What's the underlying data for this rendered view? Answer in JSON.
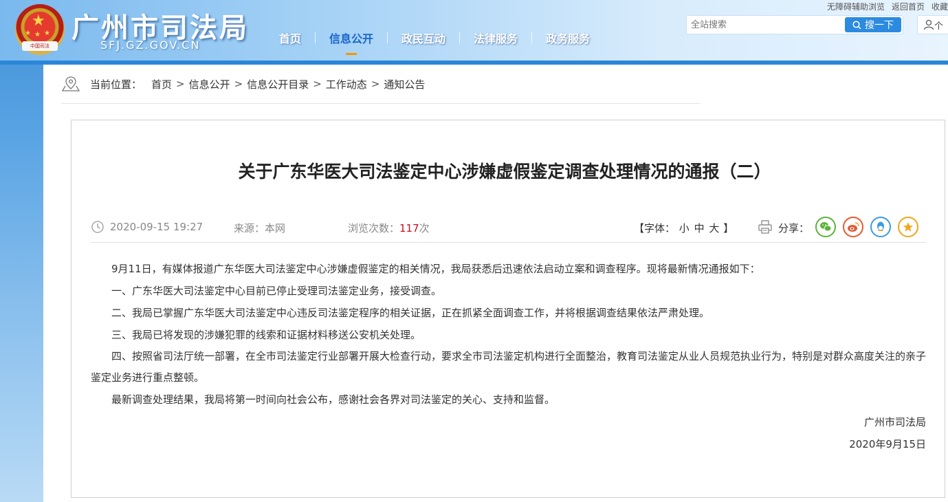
{
  "header": {
    "site_title": "广州市司法局",
    "site_domain": "SFJ.GZ.GOV.CN",
    "emblem_text": "中国司法",
    "top_links": [
      "无障碍辅助浏览",
      "返回首页",
      "收藏"
    ],
    "nav": [
      {
        "label": "首页",
        "active": false
      },
      {
        "label": "信息公开",
        "active": true
      },
      {
        "label": "政民互动",
        "active": false
      },
      {
        "label": "法律服务",
        "active": false
      },
      {
        "label": "政务服务",
        "active": false
      }
    ],
    "search": {
      "placeholder": "全站搜索",
      "button_label": "搜一下"
    },
    "user_label": "个"
  },
  "breadcrumb": {
    "label": "当前位置：",
    "items": [
      "首页",
      "信息公开",
      "信息公开目录",
      "工作动态",
      "通知公告"
    ]
  },
  "article": {
    "title": "关于广东华医大司法鉴定中心涉嫌虚假鉴定调查处理情况的通报（二）",
    "date": "2020-09-15 19:27",
    "source": "来源：本网",
    "views_label": "浏览次数：",
    "views_count": "117",
    "views_unit": "次",
    "font_open": "【字体：",
    "font_sizes": [
      "小",
      "中",
      "大"
    ],
    "font_close": "】",
    "share_label": "分享：",
    "share_targets": [
      "wechat-icon",
      "weibo-icon",
      "qq-icon",
      "favorite-icon"
    ],
    "paragraphs": [
      "9月11日，有媒体报道广东华医大司法鉴定中心涉嫌虚假鉴定的相关情况，我局获悉后迅速依法启动立案和调查程序。现将最新情况通报如下：",
      "一、广东华医大司法鉴定中心目前已停止受理司法鉴定业务，接受调查。",
      "二、我局已掌握广东华医大司法鉴定中心违反司法鉴定程序的相关证据，正在抓紧全面调查工作，并将根据调查结果依法严肃处理。",
      "三、我局已将发现的涉嫌犯罪的线索和证据材料移送公安机关处理。",
      "四、按照省司法厅统一部署，在全市司法鉴定行业部署开展大检查行动，要求全市司法鉴定机构进行全面整治，教育司法鉴定从业人员规范执业行为，特别是对群众高度关注的亲子鉴定业务进行重点整顿。",
      "最新调查处理结果，我局将第一时间向社会公布，感谢社会各界对司法鉴定的关心、支持和监督。"
    ],
    "signature_org": "广州市司法局",
    "signature_date": "2020年9月15日"
  },
  "colors": {
    "nav_active": "#1b66c9",
    "nav_underline": "#f39800",
    "views_count": "#c30d23",
    "search_button": "#2c8be0"
  }
}
